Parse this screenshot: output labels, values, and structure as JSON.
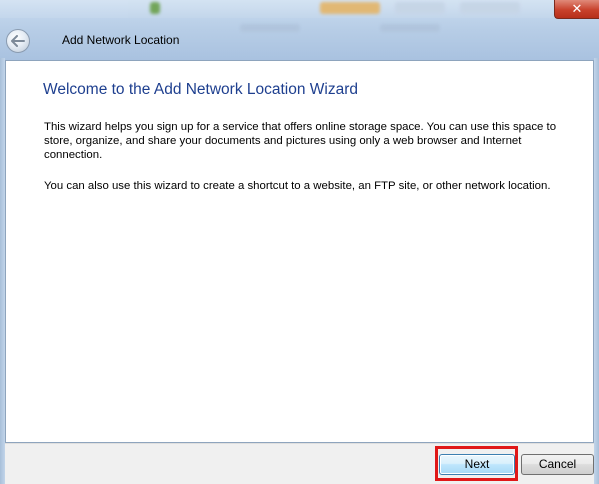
{
  "window": {
    "title": "Add Network Location",
    "close_glyph": "✕"
  },
  "content": {
    "heading": "Welcome to the Add Network Location Wizard",
    "paragraph1": "This wizard helps you sign up for a service that offers online storage space.  You can use this space to store, organize, and share your documents and pictures using only a web browser and Internet connection.",
    "paragraph2": "You can also use this wizard to create a shortcut to a website, an FTP site, or other network location."
  },
  "footer": {
    "next_label": "Next",
    "cancel_label": "Cancel"
  },
  "icons": {
    "back": "back-arrow-icon",
    "close": "close-icon"
  },
  "colors": {
    "heading": "#1e3f8f",
    "highlight": "#e01818",
    "close_button": "#c8412c"
  }
}
